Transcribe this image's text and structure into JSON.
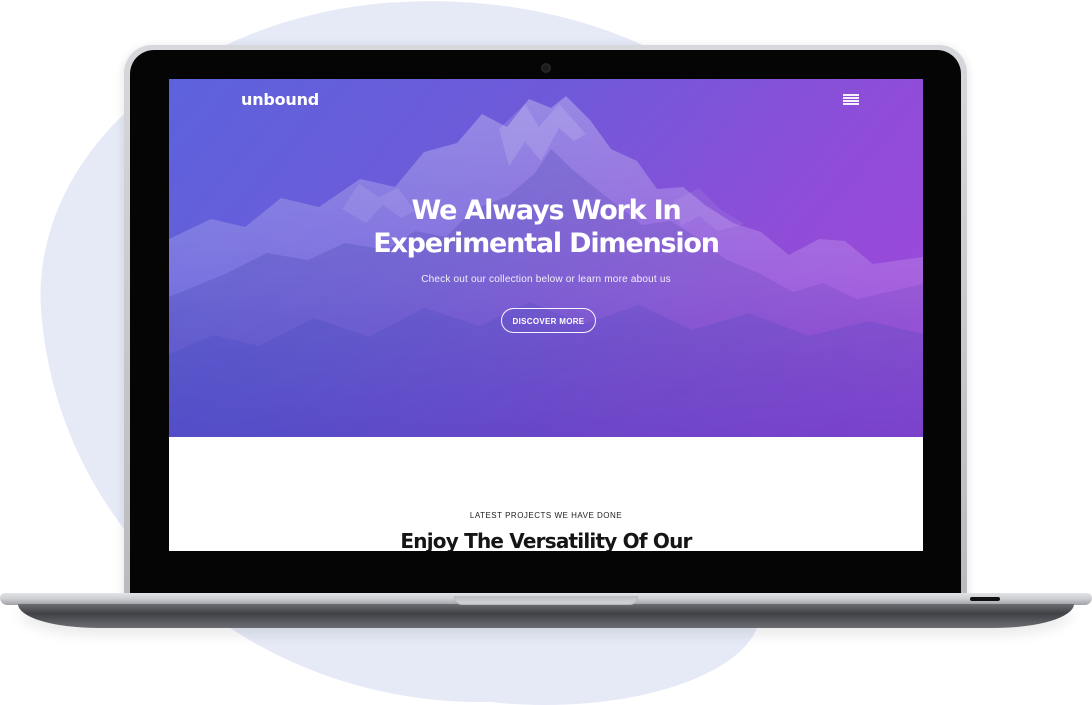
{
  "brand": {
    "name": "unbound"
  },
  "hero": {
    "title_line_1": "We Always Work In",
    "title_line_2": "Experimental Dimension",
    "subtitle": "Check out our collection below or learn more about us",
    "button_label": "DISCOVER MORE"
  },
  "projects": {
    "eyebrow": "LATEST PROJECTS WE HAVE DONE",
    "title": "Enjoy The Versatility Of Our"
  },
  "icons": {
    "menu": "hamburger-menu-icon",
    "camera": "camera-icon"
  },
  "colors": {
    "hero_gradient_start": "#5d62dc",
    "hero_gradient_mid": "#6f5ad9",
    "hero_gradient_end": "#a146da",
    "background_blob": "#e6eaf7",
    "laptop_bezel": "#050505",
    "text_light": "#ffffff",
    "text_dark": "#151515"
  }
}
